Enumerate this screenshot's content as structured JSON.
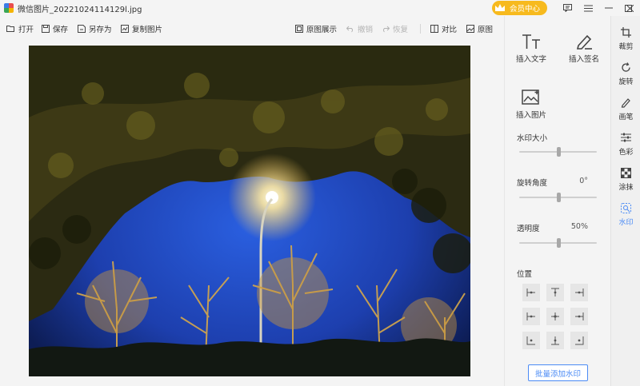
{
  "window": {
    "title": "微信图片_20221024114129l.jpg",
    "vip_label": "会员中心"
  },
  "toolbar": {
    "open": "打开",
    "save": "保存",
    "save_as": "另存为",
    "copy_image": "复制图片",
    "original_display": "原图展示",
    "undo": "撤销",
    "redo": "恢复",
    "compare": "对比",
    "original": "原图"
  },
  "panel": {
    "insert_text": "插入文字",
    "insert_signature": "插入签名",
    "insert_image": "插入图片",
    "size_label": "水印大小",
    "rotation_label": "旋转角度",
    "rotation_value": "0°",
    "opacity_label": "透明度",
    "opacity_value": "50%",
    "position_label": "位置",
    "batch_button": "批量添加水印"
  },
  "sliders": {
    "size": 0.5,
    "rotation": 0.5,
    "opacity": 0.5
  },
  "strip": {
    "items": [
      "裁剪",
      "旋转",
      "画笔",
      "色彩",
      "涂抹",
      "水印"
    ],
    "active_index": 5
  },
  "colors": {
    "accent": "#4b8bf5",
    "vip": "#f7ba1e"
  }
}
